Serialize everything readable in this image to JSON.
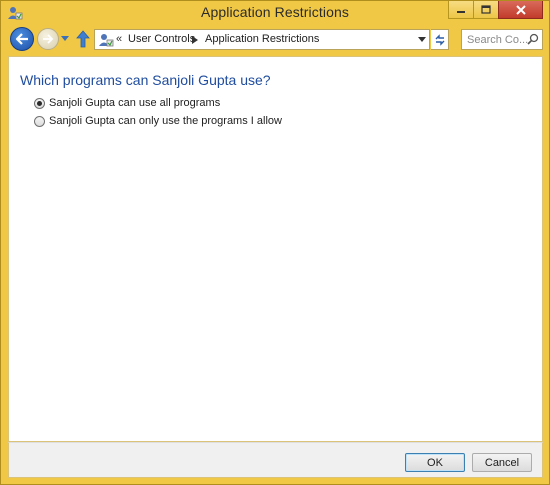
{
  "window": {
    "title": "Application Restrictions",
    "frame_color": "#f0c845"
  },
  "navigation": {
    "address_overflow": "«",
    "breadcrumbs": [
      "User Controls",
      "Application Restrictions"
    ],
    "search_placeholder": "Search Co..."
  },
  "content": {
    "heading": "Which programs can Sanjoli Gupta use?",
    "options": [
      {
        "label": "Sanjoli Gupta can use all programs",
        "selected": true
      },
      {
        "label": "Sanjoli Gupta can only use the programs I allow",
        "selected": false
      }
    ]
  },
  "footer": {
    "ok_label": "OK",
    "cancel_label": "Cancel"
  }
}
